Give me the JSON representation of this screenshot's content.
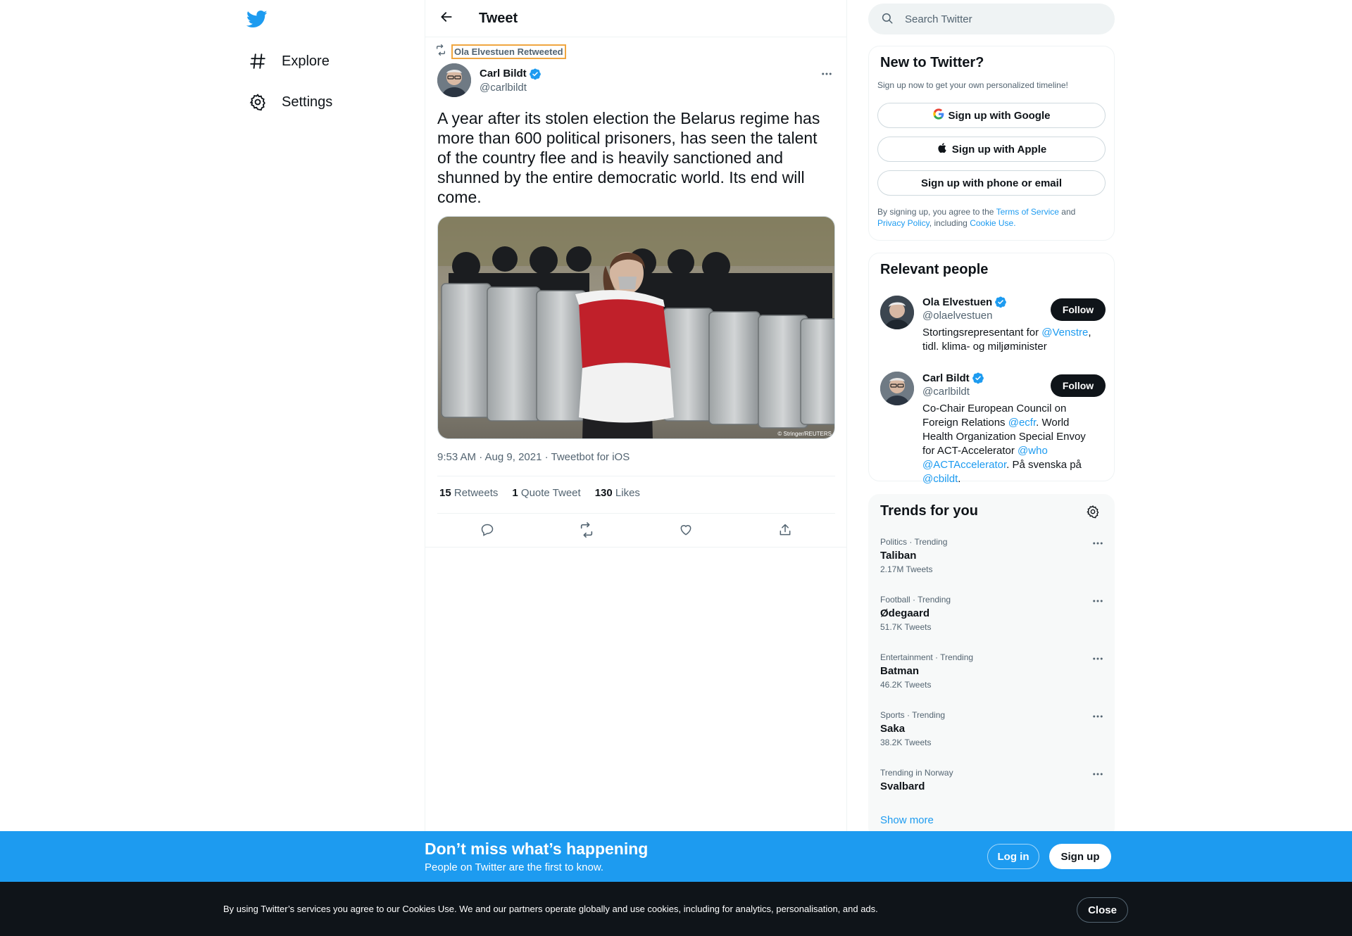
{
  "nav": {
    "logo": "twitter-bird-icon",
    "items": [
      {
        "label": "Explore",
        "icon": "hashtag-icon"
      },
      {
        "label": "Settings",
        "icon": "gear-icon"
      }
    ]
  },
  "header": {
    "title": "Tweet",
    "back_icon": "arrow-left-icon"
  },
  "tweet": {
    "retweeted_by": "Ola Elvestuen Retweeted",
    "author_name": "Carl Bildt",
    "author_handle": "@carlbildt",
    "text": "A year after its stolen election the Belarus regime has more than 600 political prisoners, has seen the talent of the country flee and is heavily sanctioned and shunned by the entire democratic world. Its end will come.",
    "photo_credit": "© Stringer/REUTERS",
    "meta": "9:53 AM · Aug 9, 2021 · Tweetbot for iOS",
    "stats": {
      "retweets_count": "15",
      "retweets_label": "Retweets",
      "quotes_count": "1",
      "quotes_label": "Quote Tweet",
      "likes_count": "130",
      "likes_label": "Likes"
    }
  },
  "search": {
    "placeholder": "Search Twitter"
  },
  "signup": {
    "title": "New to Twitter?",
    "subtitle": "Sign up now to get your own personalized timeline!",
    "google": "Sign up with Google",
    "apple": "Sign up with Apple",
    "email": "Sign up with phone or email",
    "legal_prefix": "By signing up, you agree to the",
    "terms": "Terms of Service",
    "and": "and",
    "privacy": "Privacy Policy",
    "including": ", including",
    "cookie": "Cookie Use."
  },
  "relevant": {
    "title": "Relevant people",
    "follow_label": "Follow",
    "people": [
      {
        "name": "Ola Elvestuen",
        "handle": "@olaelvestuen",
        "bio_1": "Stortingsrepresentant for ",
        "bio_mention_1": "@Venstre",
        "bio_2": ", tidl. klima- og miljøminister"
      },
      {
        "name": "Carl Bildt",
        "handle": "@carlbildt",
        "bio_1": "Co-Chair European Council on Foreign Relations ",
        "bio_mention_1": "@ecfr",
        "bio_2": ". World Health Organization Special Envoy for ACT-Accelerator ",
        "bio_mention_2": "@who",
        "bio_mention_3": "@ACTAccelerator",
        "bio_3": ". På svenska på ",
        "bio_mention_4": "@cbildt",
        "bio_4": "."
      }
    ]
  },
  "trends": {
    "title": "Trends for you",
    "items": [
      {
        "meta": "Politics · Trending",
        "name": "Taliban",
        "count": "2.17M Tweets"
      },
      {
        "meta": "Football · Trending",
        "name": "Ødegaard",
        "count": "51.7K Tweets"
      },
      {
        "meta": "Entertainment · Trending",
        "name": "Batman",
        "count": "46.2K Tweets"
      },
      {
        "meta": "Sports · Trending",
        "name": "Saka",
        "count": "38.2K Tweets"
      },
      {
        "meta": "Trending in Norway",
        "name": "Svalbard",
        "count": ""
      }
    ],
    "show_more": "Show more"
  },
  "banner": {
    "title": "Don’t miss what’s happening",
    "subtitle": "People on Twitter are the first to know.",
    "login": "Log in",
    "signup": "Sign up"
  },
  "cookie_banner": {
    "text": "By using Twitter’s services you agree to our Cookies Use. We and our partners operate globally and use cookies, including for analytics, personalisation, and ads.",
    "close": "Close"
  },
  "colors": {
    "accent": "#1d9bf0",
    "text": "#0f1419",
    "muted": "#536471",
    "dark": "#0f1419"
  }
}
